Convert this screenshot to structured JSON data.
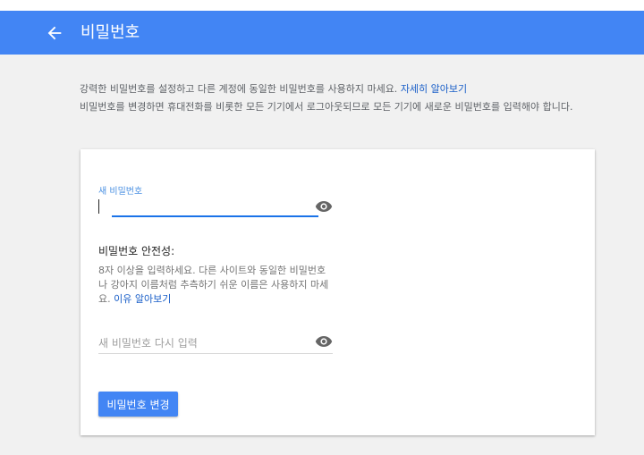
{
  "header": {
    "title": "비밀번호",
    "back_icon": "arrow-back-icon",
    "color": "#4285f4"
  },
  "intro": {
    "line1": "강력한 비밀번호를 설정하고 다른 계정에 동일한 비밀번호를 사용하지 마세요.",
    "learn_more": "자세히 알아보기",
    "line2": "비밀번호를 변경하면 휴대전화를 비롯한 모든 기기에서 로그아웃되므로 모든 기기에 새로운 비밀번호를 입력해야 합니다."
  },
  "form": {
    "new_password": {
      "label": "새 비밀번호",
      "value": "",
      "icon": "eye-icon"
    },
    "strength": {
      "title": "비밀번호 안전성:",
      "description": "8자 이상을 입력하세요. 다른 사이트와 동일한 비밀번호나 강아지 이름처럼 추측하기 쉬운 이름은 사용하지 마세요.",
      "link": "이유 알아보기"
    },
    "confirm_password": {
      "placeholder": "새 비밀번호 다시 입력",
      "value": "",
      "icon": "eye-icon"
    },
    "submit_label": "비밀번호 변경"
  },
  "colors": {
    "accent": "#4285f4",
    "link": "#1a5fc8",
    "focus_line": "#1a73e8"
  }
}
